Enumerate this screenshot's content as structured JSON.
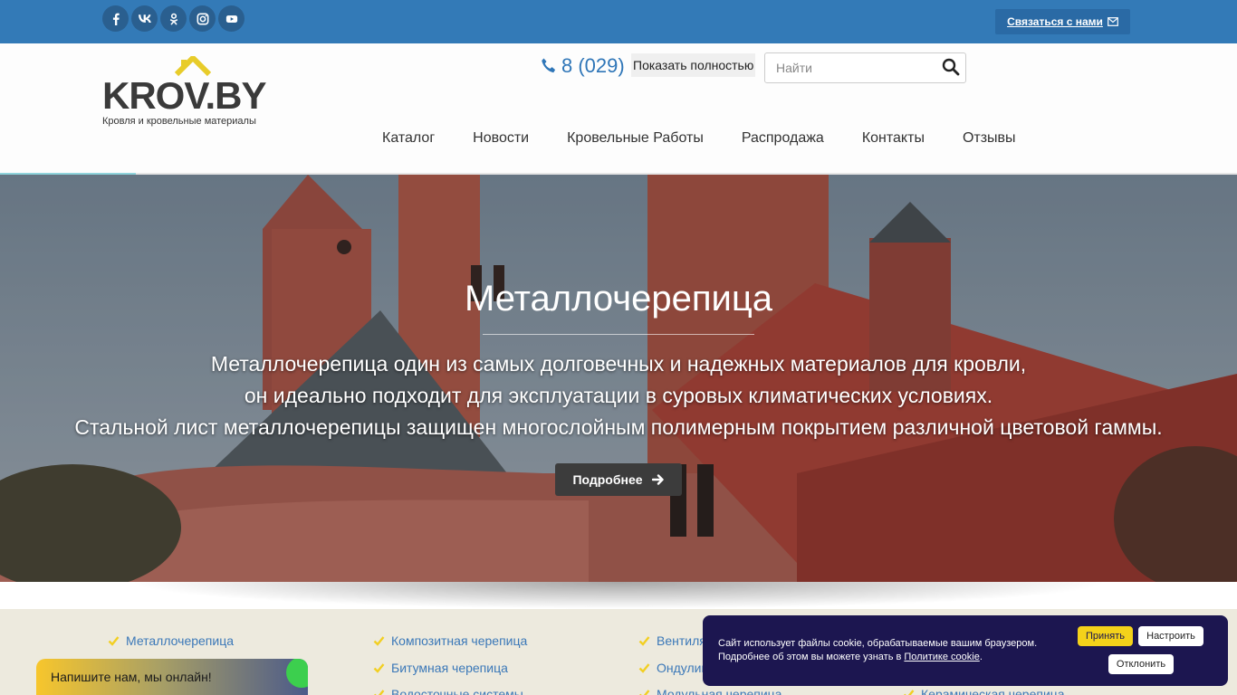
{
  "topbar": {
    "socials": [
      {
        "icon": "facebook-icon",
        "glyph": "f"
      },
      {
        "icon": "vk-icon",
        "glyph": "vk"
      },
      {
        "icon": "odnoklassniki-icon",
        "glyph": "ok"
      },
      {
        "icon": "instagram-icon",
        "glyph": "ig"
      },
      {
        "icon": "youtube-icon",
        "glyph": "yt"
      }
    ],
    "contact_label": "Связаться с нами"
  },
  "header": {
    "logo_text": "KROV.BY",
    "logo_sub": "Кровля и кровельные материалы",
    "phone": "8 (029)",
    "show_full_label": "Показать полностью",
    "search_placeholder": "Найти",
    "nav": [
      "Каталог",
      "Новости",
      "Кровельные Работы",
      "Распродажа",
      "Контакты",
      "Отзывы"
    ]
  },
  "hero": {
    "title": "Металлочерепица",
    "text_lines": [
      "Металлочерепица один из самых долговечных и надежных материалов для кровли,",
      "он идеально подходит для эксплуатации в суровых климатических условиях.",
      "Стальной лист металлочерепицы защищен многослойным полимерным покрытием различной цветовой гаммы."
    ],
    "button_label": "Подробнее"
  },
  "categories": {
    "col1": [
      "Металлочерепица",
      "Напишите нам, мы онлайн!"
    ],
    "col2": [
      "Композитная черепица",
      "Битумная черепица",
      "Водосточные системы"
    ],
    "col3": [
      "Вентиляция",
      "Ондулин",
      "Модульная черепица"
    ],
    "col4": [
      "Керамическая черепица"
    ]
  },
  "chat": {
    "label": "Напишите нам, мы онлайн!"
  },
  "cookie": {
    "text_before": "Сайт использует файлы cookie, обрабатываемые вашим браузером. Подробнее об этом вы можете узнать в ",
    "link_label": "Политике cookie",
    "text_after": ".",
    "accept_label": "Принять",
    "config_label": "Настроить",
    "decline_label": "Отклонить"
  },
  "colors": {
    "topbar": "#337ab7",
    "link": "#3b78b8",
    "accent_yellow": "#f4d21a",
    "cookie_bg": "#1c1650"
  }
}
